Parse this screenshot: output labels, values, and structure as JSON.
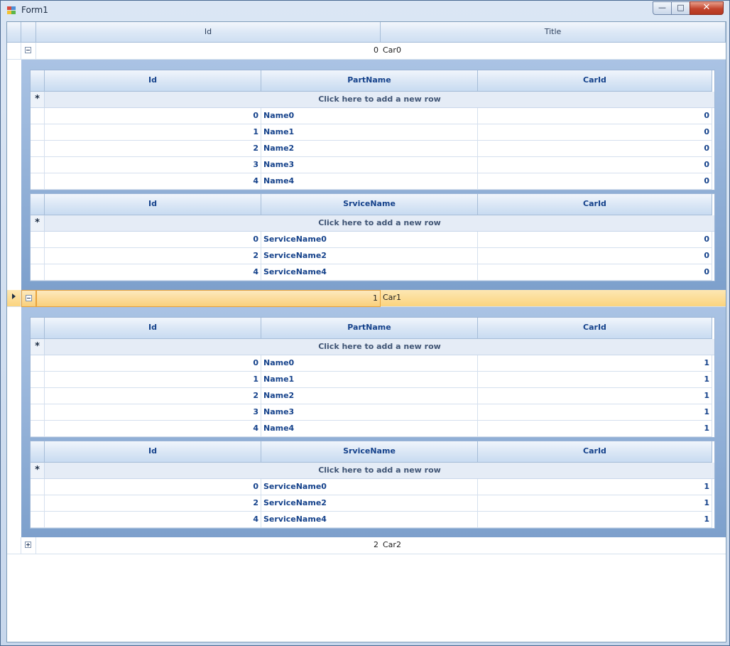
{
  "window": {
    "title": "Form1",
    "minimize_icon": "minimize-icon",
    "maximize_icon": "maximize-icon",
    "close_icon": "close-icon"
  },
  "grid": {
    "columns": [
      "Id",
      "Title"
    ],
    "rows": [
      {
        "id": "0",
        "title": "Car0",
        "expanded": true,
        "current": false,
        "parts": {
          "columns": [
            "Id",
            "PartName",
            "CarId"
          ],
          "add_row": "Click here to add a new row",
          "rows": [
            [
              "0",
              "Name0",
              "0"
            ],
            [
              "1",
              "Name1",
              "0"
            ],
            [
              "2",
              "Name2",
              "0"
            ],
            [
              "3",
              "Name3",
              "0"
            ],
            [
              "4",
              "Name4",
              "0"
            ]
          ]
        },
        "services": {
          "columns": [
            "Id",
            "SrviceName",
            "CarId"
          ],
          "add_row": "Click here to add a new row",
          "rows": [
            [
              "0",
              "ServiceName0",
              "0"
            ],
            [
              "2",
              "ServiceName2",
              "0"
            ],
            [
              "4",
              "ServiceName4",
              "0"
            ]
          ]
        }
      },
      {
        "id": "1",
        "title": "Car1",
        "expanded": true,
        "current": true,
        "parts": {
          "columns": [
            "Id",
            "PartName",
            "CarId"
          ],
          "add_row": "Click here to add a new row",
          "rows": [
            [
              "0",
              "Name0",
              "1"
            ],
            [
              "1",
              "Name1",
              "1"
            ],
            [
              "2",
              "Name2",
              "1"
            ],
            [
              "3",
              "Name3",
              "1"
            ],
            [
              "4",
              "Name4",
              "1"
            ]
          ]
        },
        "services": {
          "columns": [
            "Id",
            "SrviceName",
            "CarId"
          ],
          "add_row": "Click here to add a new row",
          "rows": [
            [
              "0",
              "ServiceName0",
              "1"
            ],
            [
              "2",
              "ServiceName2",
              "1"
            ],
            [
              "4",
              "ServiceName4",
              "1"
            ]
          ]
        }
      },
      {
        "id": "2",
        "title": "Car2",
        "expanded": false,
        "current": false
      }
    ],
    "new_row_glyph": "*"
  }
}
